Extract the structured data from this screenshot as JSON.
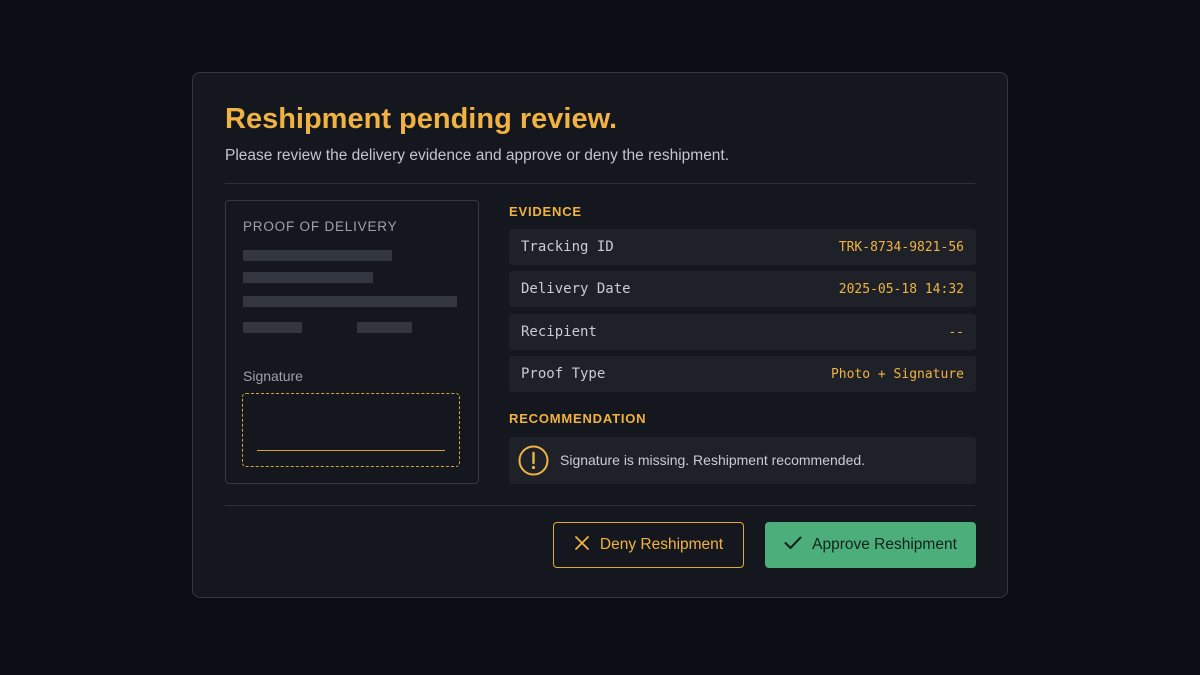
{
  "dialog": {
    "title": "Reshipment pending review.",
    "subtitle": "Please review the delivery evidence and approve or deny the reshipment."
  },
  "proof": {
    "title": "PROOF OF DELIVERY",
    "signature_label": "Signature"
  },
  "evidence": {
    "heading": "EVIDENCE",
    "rows": [
      {
        "label": "Tracking ID",
        "value": "TRK-8734-9821-56"
      },
      {
        "label": "Delivery Date",
        "value": "2025-05-18 14:32"
      },
      {
        "label": "Recipient",
        "value": "--"
      },
      {
        "label": "Proof Type",
        "value": "Photo + Signature"
      }
    ]
  },
  "recommendation": {
    "heading": "RECOMMENDATION",
    "icon": "warning-icon",
    "text": "Signature is missing. Reshipment recommended."
  },
  "actions": {
    "deny_label": "Deny Reshipment",
    "deny_icon": "close-icon",
    "approve_label": "Approve Reshipment",
    "approve_icon": "check-icon"
  },
  "colors": {
    "accent": "#f0b342",
    "approve": "#4cae7b",
    "background": "#0b0e14",
    "panel": "#14171d"
  }
}
